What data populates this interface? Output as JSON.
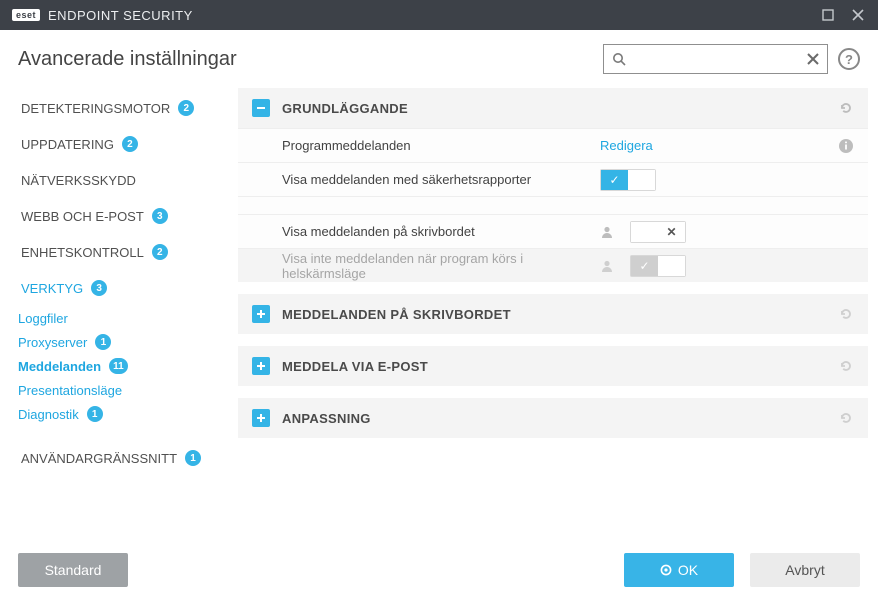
{
  "title": {
    "brand_badge": "eset",
    "brand_text": "ENDPOINT SECURITY"
  },
  "header": {
    "title": "Avancerade inställningar"
  },
  "search": {
    "placeholder": ""
  },
  "sidebar": {
    "items": [
      {
        "label": "DETEKTERINGSMOTOR",
        "badge": "2"
      },
      {
        "label": "UPPDATERING",
        "badge": "2"
      },
      {
        "label": "NÄTVERKSSKYDD",
        "badge": ""
      },
      {
        "label": "WEBB OCH E-POST",
        "badge": "3"
      },
      {
        "label": "ENHETSKONTROLL",
        "badge": "2"
      },
      {
        "label": "VERKTYG",
        "badge": "3"
      },
      {
        "label": "ANVÄNDARGRÄNSSNITT",
        "badge": "1"
      }
    ],
    "sub_items": [
      {
        "label": "Loggfiler",
        "badge": ""
      },
      {
        "label": "Proxyserver",
        "badge": "1"
      },
      {
        "label": "Meddelanden",
        "badge": "11"
      },
      {
        "label": "Presentationsläge",
        "badge": ""
      },
      {
        "label": "Diagnostik",
        "badge": "1"
      }
    ]
  },
  "panels": {
    "basic": {
      "title": "GRUNDLÄGGANDE",
      "rows": {
        "app_messages_label": "Programmeddelanden",
        "app_messages_action": "Redigera",
        "show_reports_label": "Visa meddelanden med säkerhetsrapporter",
        "desktop_msgs_label": "Visa meddelanden på skrivbordet",
        "fullscreen_label": "Visa inte meddelanden när program körs i helskärmsläge"
      }
    },
    "desktop": {
      "title": "MEDDELANDEN PÅ SKRIVBORDET"
    },
    "email": {
      "title": "MEDDELA VIA E-POST"
    },
    "custom": {
      "title": "ANPASSNING"
    }
  },
  "footer": {
    "default": "Standard",
    "ok": "OK",
    "cancel": "Avbryt"
  }
}
